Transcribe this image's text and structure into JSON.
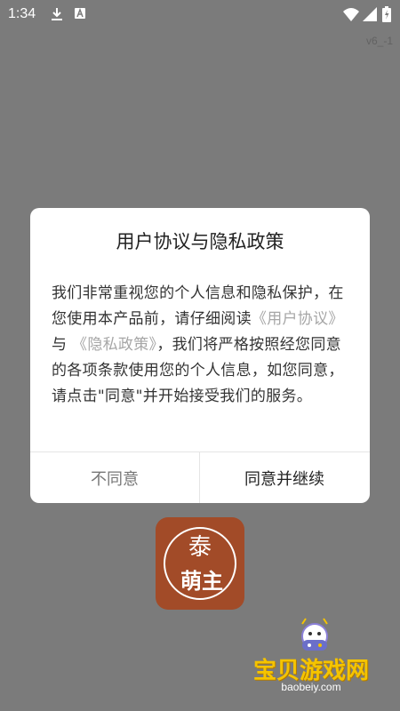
{
  "status_bar": {
    "time": "1:34",
    "icons": [
      "download-icon",
      "a-badge-icon",
      "wifi-icon",
      "signal-icon",
      "battery-icon"
    ]
  },
  "version": "v6_-1",
  "dialog": {
    "title": "用户协议与隐私政策",
    "body_part1": "我们非常重视您的个人信息和隐私保护，在您使用本产品前，请仔细阅读",
    "link_user_agreement": "《用户协议》",
    "connector": " 与 ",
    "link_privacy_policy": "《隐私政策》",
    "body_part2": "，我们将严格按照经您同意的各项条款使用您的个人信息，如您同意，请点击\"同意\"并开始接受我们的服务。",
    "disagree_label": "不同意",
    "agree_label": "同意并继续"
  },
  "app_logo": {
    "char_top": "泰",
    "char_bottom": "萌主"
  },
  "watermark": {
    "title": "宝贝游戏网",
    "url": "baobeiy.com"
  },
  "colors": {
    "overlay": "#7b7b7b",
    "logo_bg": "#a24b28",
    "link": "#a6a6a6",
    "watermark": "#f5c400"
  }
}
